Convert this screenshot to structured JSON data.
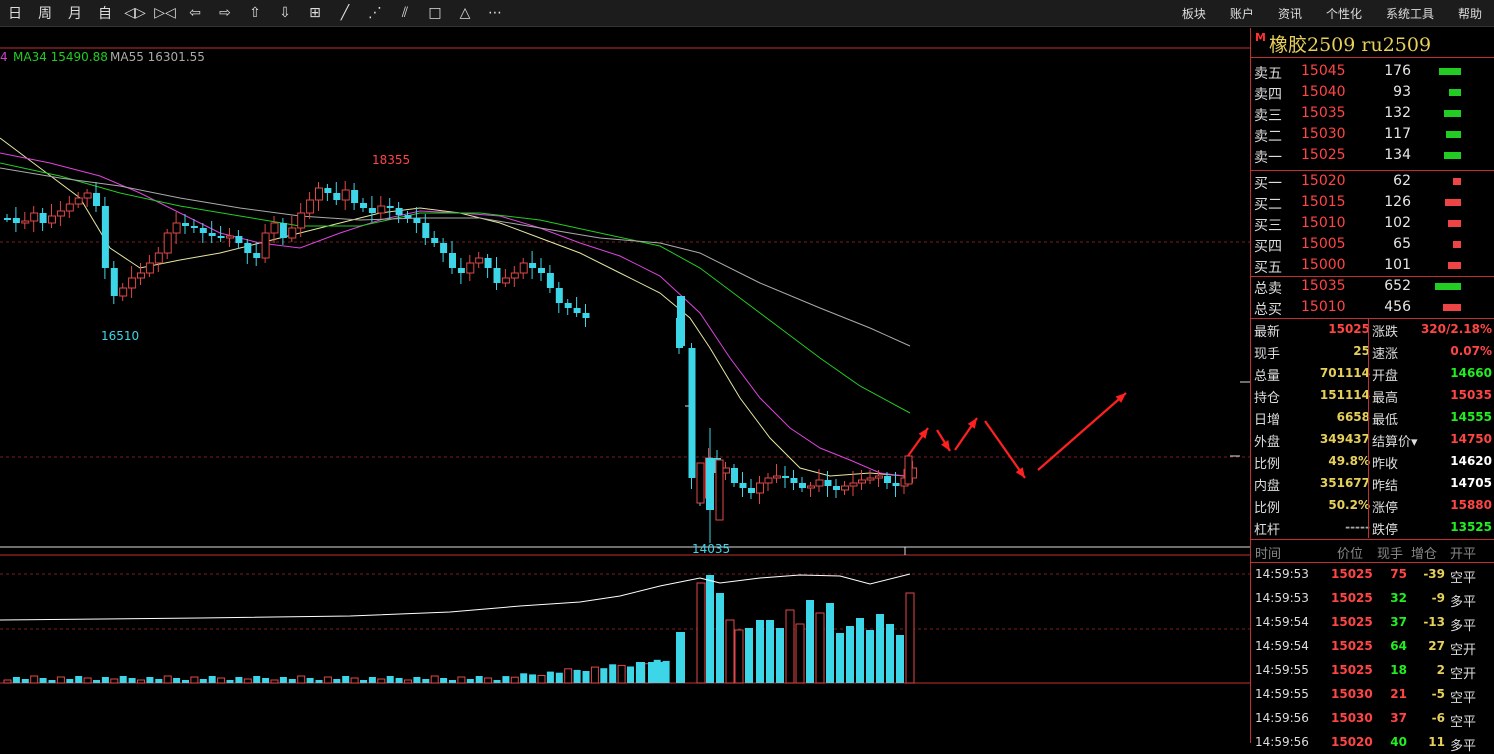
{
  "toolbar": {
    "left": [
      {
        "label": "日",
        "name": "day-button"
      },
      {
        "label": "周",
        "name": "week-button"
      },
      {
        "label": "月",
        "name": "month-button"
      },
      {
        "label": "自",
        "name": "custom-period-button"
      },
      {
        "label": "◁▷",
        "name": "zoom-fit-icon"
      },
      {
        "label": "▷◁",
        "name": "zoom-in-icon"
      },
      {
        "label": "⇦",
        "name": "arrow-left-icon"
      },
      {
        "label": "⇨",
        "name": "arrow-right-icon"
      },
      {
        "label": "⇧",
        "name": "arrow-up-icon"
      },
      {
        "label": "⇩",
        "name": "arrow-down-icon"
      },
      {
        "label": "⊞",
        "name": "crosshair-icon"
      },
      {
        "label": "╱",
        "name": "line-tool-icon"
      },
      {
        "label": "⋰",
        "name": "ray-tool-icon"
      },
      {
        "label": "⫽",
        "name": "parallel-tool-icon"
      },
      {
        "label": "□",
        "name": "rectangle-tool-icon"
      },
      {
        "label": "△",
        "name": "triangle-tool-icon"
      },
      {
        "label": "⋯",
        "name": "more-icon"
      }
    ],
    "right": [
      "板块",
      "账户",
      "资讯",
      "个性化",
      "系统工具",
      "帮助"
    ]
  },
  "indicators": {
    "ma34": "MA34 15490.88",
    "ma55": "MA55 16301.55",
    "prefix": "4"
  },
  "annotations": {
    "high": "18355",
    "low1": "16510",
    "low2": "14035"
  },
  "panel": {
    "marker": "M",
    "title": "橡胶2509  ru2509",
    "sell": [
      {
        "label": "卖五",
        "price": "15045",
        "vol": "176",
        "bar": 0.85
      },
      {
        "label": "卖四",
        "price": "15040",
        "vol": "93",
        "bar": 0.45
      },
      {
        "label": "卖三",
        "price": "15035",
        "vol": "132",
        "bar": 0.65
      },
      {
        "label": "卖二",
        "price": "15030",
        "vol": "117",
        "bar": 0.58
      },
      {
        "label": "卖一",
        "price": "15025",
        "vol": "134",
        "bar": 0.66
      }
    ],
    "buy": [
      {
        "label": "买一",
        "price": "15020",
        "vol": "62",
        "bar": 0.3
      },
      {
        "label": "买二",
        "price": "15015",
        "vol": "126",
        "bar": 0.63
      },
      {
        "label": "买三",
        "price": "15010",
        "vol": "102",
        "bar": 0.5
      },
      {
        "label": "买四",
        "price": "15005",
        "vol": "65",
        "bar": 0.32
      },
      {
        "label": "买五",
        "price": "15000",
        "vol": "101",
        "bar": 0.5
      }
    ],
    "totals": [
      {
        "label": "总卖",
        "price": "15035",
        "vol": "652",
        "bar": 1.0,
        "color": "#22cc22"
      },
      {
        "label": "总买",
        "price": "15010",
        "vol": "456",
        "bar": 0.7,
        "color": "#ee4444"
      }
    ],
    "quote": [
      {
        "l": "最新",
        "v": "15025",
        "vc": "#ff4545",
        "l2": "涨跌",
        "v2": "320/2.18%",
        "v2c": "#ff4545"
      },
      {
        "l": "现手",
        "v": "25",
        "vc": "#e6d05a",
        "l2": "速涨",
        "v2": "0.07%",
        "v2c": "#ff4545"
      },
      {
        "l": "总量",
        "v": "701114",
        "vc": "#e6d05a",
        "l2": "开盘",
        "v2": "14660",
        "v2c": "#22ee22"
      },
      {
        "l": "持仓",
        "v": "151114",
        "vc": "#e6d05a",
        "l2": "最高",
        "v2": "15035",
        "v2c": "#ff4545"
      },
      {
        "l": "日增",
        "v": "6658",
        "vc": "#e6d05a",
        "l2": "最低",
        "v2": "14555",
        "v2c": "#22ee22"
      },
      {
        "l": "外盘",
        "v": "349437",
        "vc": "#e6d05a",
        "l2": "结算价▾",
        "v2": "14750",
        "v2c": "#ff4545"
      },
      {
        "l": "比例",
        "v": "49.8%",
        "vc": "#e6d05a",
        "l2": "昨收",
        "v2": "14620",
        "v2c": "#ffffff"
      },
      {
        "l": "内盘",
        "v": "351677",
        "vc": "#e6d05a",
        "l2": "昨结",
        "v2": "14705",
        "v2c": "#ffffff"
      },
      {
        "l": "比例",
        "v": "50.2%",
        "vc": "#e6d05a",
        "l2": "涨停",
        "v2": "15880",
        "v2c": "#ff4545"
      },
      {
        "l": "杠杆",
        "v": "-----",
        "vc": "#aaaaaa",
        "l2": "跌停",
        "v2": "13525",
        "v2c": "#22ee22"
      }
    ],
    "tick_header": [
      "时间",
      "价位",
      "现手",
      "增仓",
      "开平"
    ],
    "ticks": [
      {
        "time": "14:59:53",
        "price": "15025",
        "pc": "#ff4545",
        "hand": "75",
        "hc": "#ff4545",
        "inc": "-39",
        "ic": "#e6d05a",
        "type": "空平"
      },
      {
        "time": "14:59:53",
        "price": "15025",
        "pc": "#ff4545",
        "hand": "32",
        "hc": "#22ee22",
        "inc": "-9",
        "ic": "#e6d05a",
        "type": "多平"
      },
      {
        "time": "14:59:54",
        "price": "15025",
        "pc": "#ff4545",
        "hand": "37",
        "hc": "#22ee22",
        "inc": "-13",
        "ic": "#e6d05a",
        "type": "多平"
      },
      {
        "time": "14:59:54",
        "price": "15025",
        "pc": "#ff4545",
        "hand": "64",
        "hc": "#22ee22",
        "inc": "27",
        "ic": "#e6d05a",
        "type": "空开"
      },
      {
        "time": "14:59:55",
        "price": "15025",
        "pc": "#ff4545",
        "hand": "18",
        "hc": "#22ee22",
        "inc": "2",
        "ic": "#e6d05a",
        "type": "空开"
      },
      {
        "time": "14:59:55",
        "price": "15030",
        "pc": "#ff4545",
        "hand": "21",
        "hc": "#ff4545",
        "inc": "-5",
        "ic": "#e6d05a",
        "type": "空平"
      },
      {
        "time": "14:59:56",
        "price": "15030",
        "pc": "#ff4545",
        "hand": "37",
        "hc": "#ff4545",
        "inc": "-6",
        "ic": "#e6d05a",
        "type": "空平"
      },
      {
        "time": "14:59:56",
        "price": "15020",
        "pc": "#ff4545",
        "hand": "40",
        "hc": "#22ee22",
        "inc": "11",
        "ic": "#e6d05a",
        "type": "多平"
      }
    ]
  }
}
